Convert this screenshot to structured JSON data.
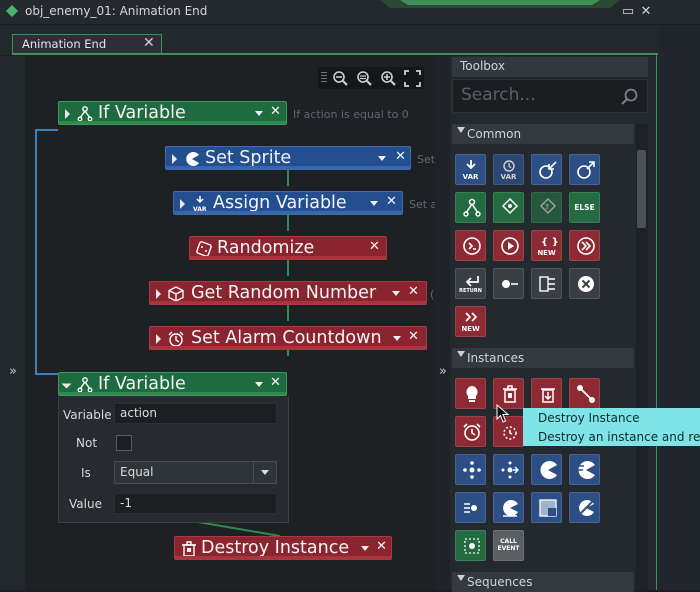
{
  "window": {
    "title": "obj_enemy_01: Animation End",
    "min_glyph": "▭",
    "close_glyph": "✕"
  },
  "tab": {
    "label": "Animation End",
    "close_glyph": "✕"
  },
  "gutter": {
    "left_chevron": "»",
    "mid_chevron": "»"
  },
  "actions": [
    {
      "name": "If Variable",
      "hint": "If action is equal to 0"
    },
    {
      "name": "Set Sprite",
      "hint": "Set"
    },
    {
      "name": "Assign Variable",
      "hint": "Set a"
    },
    {
      "name": "Randomize",
      "hint": ""
    },
    {
      "name": "Get Random Number",
      "hint": "("
    },
    {
      "name": "Set Alarm Countdown",
      "hint": ""
    },
    {
      "name": "If Variable",
      "hint": ""
    },
    {
      "name": "Destroy Instance",
      "hint": ""
    }
  ],
  "expanded": {
    "variable_label": "Variable",
    "variable_value": "action",
    "not_label": "Not",
    "is_label": "Is",
    "is_value": "Equal",
    "value_label": "Value",
    "value_value": "-1"
  },
  "toolbox": {
    "header": "Toolbox",
    "search_placeholder": "Search...",
    "sections": [
      "Common",
      "Instances",
      "Sequences"
    ],
    "labels": {
      "var": "VAR",
      "else": "ELSE",
      "new": "NEW",
      "return": "RETURN",
      "call_event": "CALL EVENT"
    }
  },
  "tooltip": {
    "title": "Destroy Instance",
    "desc": "Destroy an instance and remo"
  },
  "colors": {
    "accent_green": "#3f8f5a",
    "action_green": "#1e6b40",
    "action_blue": "#234f91",
    "action_red": "#8a2530",
    "tooltip": "#7fe4e8"
  }
}
